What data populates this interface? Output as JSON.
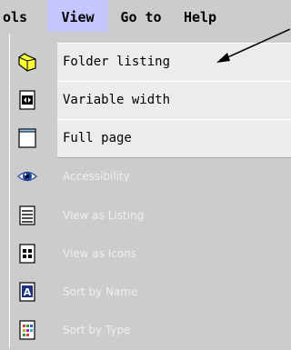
{
  "menubar": {
    "items": [
      {
        "label": "ols"
      },
      {
        "label": "View",
        "active": true
      },
      {
        "label": "Go to"
      },
      {
        "label": "Help"
      }
    ]
  },
  "view_menu": {
    "items": [
      {
        "label": "Folder listing",
        "icon": "folder-icon",
        "enabled": true
      },
      {
        "label": "Variable width",
        "icon": "variable-width-icon",
        "enabled": true
      },
      {
        "label": "Full page",
        "icon": "full-page-icon",
        "enabled": true
      },
      {
        "label": "Accessibility",
        "icon": "eye-icon",
        "enabled": false
      },
      {
        "label": "View as Listing",
        "icon": "listing-icon",
        "enabled": false
      },
      {
        "label": "View as Icons",
        "icon": "icons-view-icon",
        "enabled": false
      },
      {
        "label": "Sort by Name",
        "icon": "sort-name-icon",
        "enabled": false
      },
      {
        "label": "Sort by Type",
        "icon": "sort-type-icon",
        "enabled": false
      }
    ]
  },
  "colors": {
    "background": "#cccccc",
    "active_menu": "#c6c6ff",
    "item_highlight": "#ececec",
    "disabled_text": "#efefef"
  }
}
